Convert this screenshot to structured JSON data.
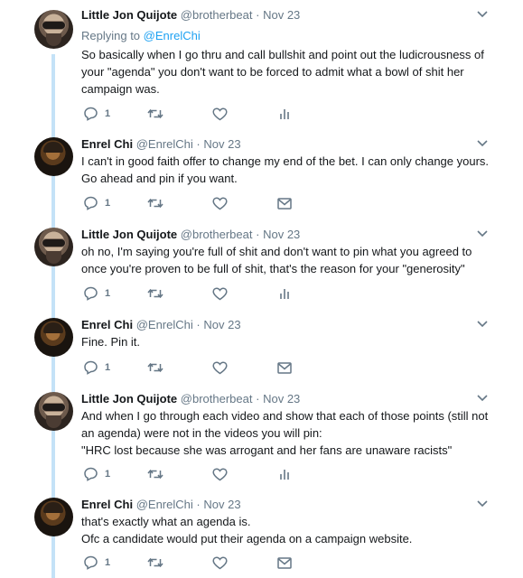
{
  "tweets": [
    {
      "author": "Little Jon Quijote",
      "handle": "@brotherbeat",
      "date": "Nov 23",
      "reply_prefix": "Replying to",
      "reply_to": "@EnrelChi",
      "lines": [
        "So basically when I go thru and call bullshit and point out the ludicrousness of",
        "your \"agenda\" you don't want to be forced to admit what a bowl of shit her",
        "campaign was."
      ],
      "reply_count": "1",
      "last_action": "analytics-icon"
    },
    {
      "author": "Enrel Chi",
      "handle": "@EnrelChi",
      "date": "Nov 23",
      "lines": [
        "I can't in good faith offer to change my end of the bet. I can only change yours.",
        "Go ahead and pin if you want."
      ],
      "reply_count": "1",
      "last_action": "message-icon"
    },
    {
      "author": "Little Jon Quijote",
      "handle": "@brotherbeat",
      "date": "Nov 23",
      "lines": [
        "oh no, I'm saying you're full of shit and don't want to pin what you agreed to",
        "once you're proven to be full of shit, that's the reason for your \"generosity\""
      ],
      "reply_count": "1",
      "last_action": "analytics-icon"
    },
    {
      "author": "Enrel Chi",
      "handle": "@EnrelChi",
      "date": "Nov 23",
      "lines": [
        "Fine. Pin it."
      ],
      "reply_count": "1",
      "last_action": "message-icon"
    },
    {
      "author": "Little Jon Quijote",
      "handle": "@brotherbeat",
      "date": "Nov 23",
      "lines": [
        "And when I go through each video and show that each of those points (still not",
        "an agenda) were not in the videos you will pin:",
        "\"HRC lost because she was arrogant and her fans are unaware racists\""
      ],
      "reply_count": "1",
      "last_action": "analytics-icon"
    },
    {
      "author": "Enrel Chi",
      "handle": "@EnrelChi",
      "date": "Nov 23",
      "lines": [
        "that's exactly what an agenda is.",
        "Ofc a candidate would put their agenda on a campaign website."
      ],
      "reply_count": "1",
      "last_action": "message-icon"
    }
  ],
  "separator": "·",
  "colors": {
    "text": "#14171a",
    "muted": "#657786",
    "link": "#1da1f2",
    "thread_line": "#c4e2f7"
  }
}
